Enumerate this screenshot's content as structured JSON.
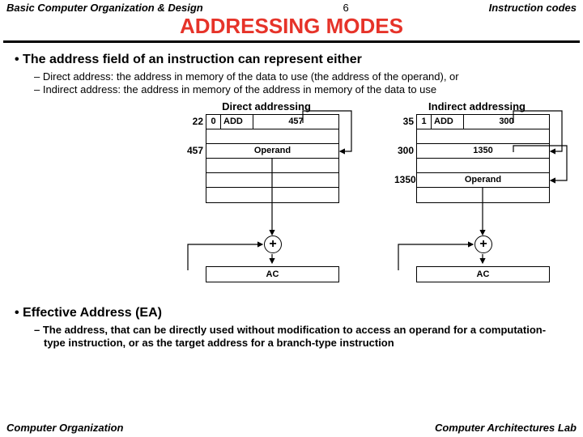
{
  "header": {
    "left": "Basic Computer Organization & Design",
    "center": "6",
    "right": "Instruction codes"
  },
  "title": "ADDRESSING MODES",
  "bullet_main": "The address field of an instruction can represent either",
  "sub1": "Direct address: the address in memory of the data to use (the address of the operand), or",
  "sub2": "Indirect address: the address in memory of the address in memory of the data to use",
  "direct": {
    "title": "Direct addressing",
    "addr1": "22",
    "i": "0",
    "op": "ADD",
    "val": "457",
    "addr2": "457",
    "content2": "Operand"
  },
  "indirect": {
    "title": "Indirect addressing",
    "addr1": "35",
    "i": "1",
    "op": "ADD",
    "val": "300",
    "addr2": "300",
    "content2": "1350",
    "addr3": "1350",
    "content3": "Operand"
  },
  "adder": "+",
  "ac": "AC",
  "bullet_ea": "Effective Address (EA)",
  "sub_ea": "The address, that can be directly used without modification to access an operand for a computation-type instruction, or as the target address for a branch-type instruction",
  "footer": {
    "left": "Computer Organization",
    "right": "Computer Architectures Lab"
  }
}
